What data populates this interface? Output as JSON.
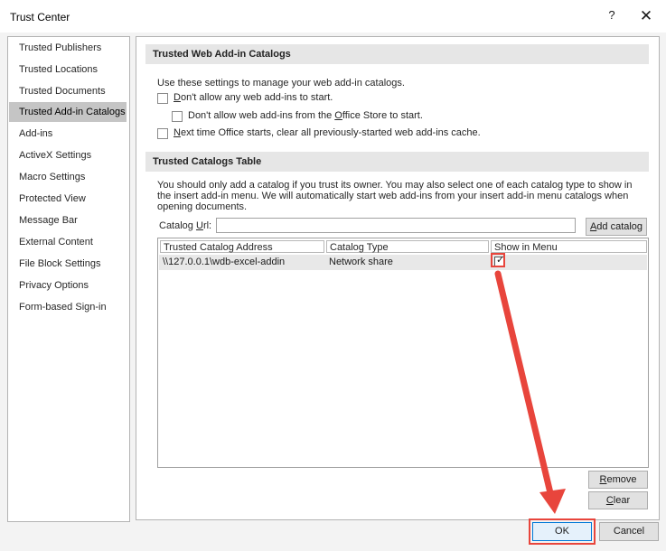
{
  "dialog": {
    "title": "Trust Center",
    "help_glyph": "?",
    "close_glyph": "✕"
  },
  "sidebar": {
    "items": [
      {
        "label": "Trusted Publishers"
      },
      {
        "label": "Trusted Locations"
      },
      {
        "label": "Trusted Documents"
      },
      {
        "label": "Trusted Add-in Catalogs",
        "selected": true
      },
      {
        "label": "Add-ins"
      },
      {
        "label": "ActiveX Settings"
      },
      {
        "label": "Macro Settings"
      },
      {
        "label": "Protected View"
      },
      {
        "label": "Message Bar"
      },
      {
        "label": "External Content"
      },
      {
        "label": "File Block Settings"
      },
      {
        "label": "Privacy Options"
      },
      {
        "label": "Form-based Sign-in"
      }
    ]
  },
  "web_catalogs": {
    "header": "Trusted Web Add-in Catalogs",
    "intro": "Use these settings to manage your web add-in catalogs.",
    "opt1": {
      "pre": "",
      "u": "D",
      "post": "on't allow any web add-ins to start.",
      "checked": false
    },
    "opt2": {
      "pre": "Don't allow web add-ins from the ",
      "u": "O",
      "post": "ffice Store to start.",
      "checked": false
    },
    "opt3": {
      "pre": "",
      "u": "N",
      "post": "ext time Office starts, clear all previously-started web add-ins cache.",
      "checked": false
    }
  },
  "catalogs_table": {
    "header": "Trusted Catalogs Table",
    "description": "You should only add a catalog if you trust its owner. You may also select one of each catalog type to show in the insert add-in menu. We will automatically start web add-ins from your insert add-in menu catalogs when opening documents.",
    "url_label_pre": "Catalog ",
    "url_label_u": "U",
    "url_label_post": "rl:",
    "url_value": "",
    "add_button": {
      "u": "A",
      "post": "dd catalog"
    },
    "columns": [
      "Trusted Catalog Address",
      "Catalog Type",
      "Show in Menu"
    ],
    "rows": [
      {
        "address": "\\\\127.0.0.1\\wdb-excel-addin",
        "type": "Network share",
        "show_in_menu": true
      }
    ],
    "remove_button": {
      "u": "R",
      "post": "emove"
    },
    "clear_button": {
      "u": "C",
      "post": "lear"
    }
  },
  "footer": {
    "ok": "OK",
    "cancel": "Cancel"
  },
  "annotation": {
    "color": "#e8453c"
  }
}
